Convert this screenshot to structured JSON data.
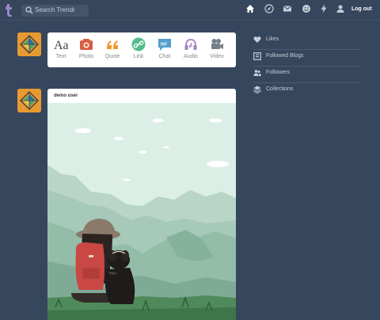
{
  "header": {
    "search_placeholder": "Search Trendr",
    "logout_label": "Log out",
    "icons": [
      "home-icon",
      "compass-icon",
      "mail-icon",
      "smiley-icon",
      "lightning-icon",
      "person-icon"
    ]
  },
  "composer": {
    "types": [
      {
        "label": "Text",
        "icon": "text-icon",
        "color": "#444444"
      },
      {
        "label": "Photo",
        "icon": "camera-icon",
        "color": "#d95e40"
      },
      {
        "label": "Quote",
        "icon": "quote-icon",
        "color": "#f2992e"
      },
      {
        "label": "Link",
        "icon": "link-icon",
        "color": "#56bc8a"
      },
      {
        "label": "Chat",
        "icon": "chat-icon",
        "color": "#529ecc"
      },
      {
        "label": "Audio",
        "icon": "headphones-icon",
        "color": "#a77dc2"
      },
      {
        "label": "Video",
        "icon": "video-camera-icon",
        "color": "#748089"
      }
    ]
  },
  "post": {
    "username": "demo user"
  },
  "sidebar": {
    "items": [
      {
        "label": "Likes",
        "icon": "heart-icon"
      },
      {
        "label": "Followed Blogs",
        "icon": "book-icon"
      },
      {
        "label": "Followers",
        "icon": "people-icon"
      },
      {
        "label": "Collections",
        "icon": "layers-icon"
      }
    ]
  },
  "colors": {
    "background": "#36465d",
    "avatar": "#e79a32"
  }
}
